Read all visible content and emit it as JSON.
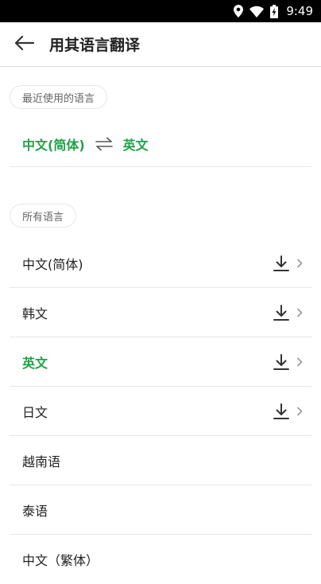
{
  "status_bar": {
    "time": "9:49",
    "icons": [
      "location-icon",
      "wifi-icon",
      "battery-charging-icon"
    ]
  },
  "header": {
    "title": "用其语言翻译",
    "back_icon": "back-arrow-icon"
  },
  "recent": {
    "section_label": "最近使用的语言",
    "source_language": "中文(简体)",
    "target_language": "英文",
    "swap_icon": "swap-icon"
  },
  "all_languages": {
    "section_label": "所有语言",
    "items": [
      {
        "name": "中文(简体)",
        "downloadable": true,
        "selected": false
      },
      {
        "name": "韩文",
        "downloadable": true,
        "selected": false
      },
      {
        "name": "英文",
        "downloadable": true,
        "selected": true
      },
      {
        "name": "日文",
        "downloadable": true,
        "selected": false
      },
      {
        "name": "越南语",
        "downloadable": false,
        "selected": false
      },
      {
        "name": "泰语",
        "downloadable": false,
        "selected": false
      },
      {
        "name": "中文（繁体）",
        "downloadable": false,
        "selected": false
      }
    ]
  },
  "colors": {
    "accent": "#1fa34a",
    "status_bar": "#000000",
    "divider": "#e6e6e6"
  }
}
